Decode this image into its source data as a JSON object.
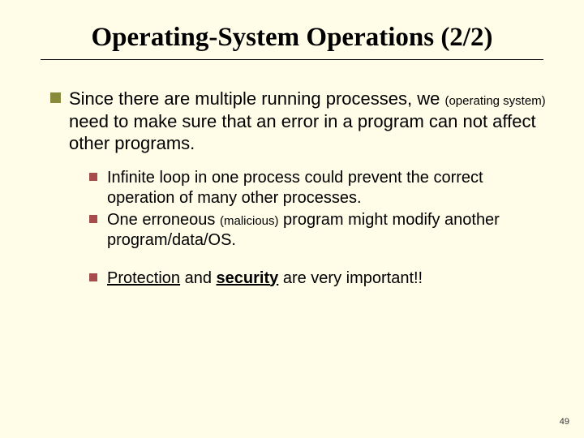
{
  "title": "Operating-System Operations (2/2)",
  "main": {
    "part1": "Since there are multiple running processes, we ",
    "paren": "(operating system)",
    "part2": " need to make sure that an error in a program can not affect other programs."
  },
  "sub": {
    "item1": "Infinite loop in one process could prevent the correct operation of many other processes.",
    "item2a": "One erroneous ",
    "item2paren": "(malicious)",
    "item2b": " program might modify another program/data/OS.",
    "item3a": "Protection",
    "item3b": " and ",
    "item3c": "security",
    "item3d": " are very important!!"
  },
  "page": "49"
}
